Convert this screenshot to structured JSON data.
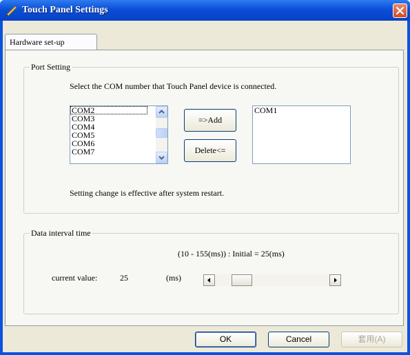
{
  "window": {
    "title": "Touch Panel Settings"
  },
  "tabs": [
    {
      "label": "Hardware set-up"
    }
  ],
  "port_setting": {
    "legend": "Port Setting",
    "instruction": "Select the COM number that Touch Panel device is connected.",
    "available_ports": [
      "COM2",
      "COM3",
      "COM4",
      "COM5",
      "COM6",
      "COM7"
    ],
    "add_label": "=>Add",
    "delete_label": "Delete<=",
    "selected_ports": [
      "COM1"
    ],
    "note": "Setting change is effective after system restart."
  },
  "data_interval": {
    "legend": "Data interval time",
    "range_text": "(10 - 155(ms)) : Initial = 25(ms)",
    "current_label": "current value:",
    "current_value": "25",
    "unit": "(ms)",
    "slider_min": 10,
    "slider_max": 155
  },
  "footer": {
    "ok_label": "OK",
    "cancel_label": "Cancel",
    "apply_label": "套用(A)"
  },
  "colors": {
    "titlebar": "#0a53e0",
    "face": "#ece9d8",
    "close": "#d24a25"
  }
}
